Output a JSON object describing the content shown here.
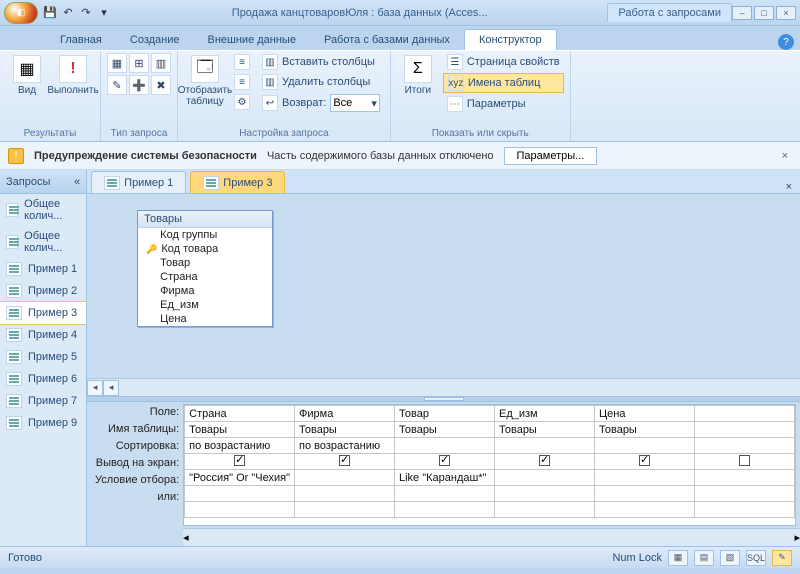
{
  "title": "Продажа канцтоваровЮля : база данных (Acces...",
  "context_tab": "Работа с запросами",
  "tabs": [
    "Главная",
    "Создание",
    "Внешние данные",
    "Работа с базами данных",
    "Конструктор"
  ],
  "ribbon": {
    "results": {
      "view": "Вид",
      "run": "Выполнить",
      "label": "Результаты"
    },
    "querytype": {
      "label": "Тип запроса"
    },
    "setup": {
      "showtable": "Отобразить таблицу",
      "insert_cols": "Вставить столбцы",
      "delete_cols": "Удалить столбцы",
      "return": "Возврат:",
      "return_value": "Все",
      "label": "Настройка запроса"
    },
    "totals": {
      "label": "Итоги"
    },
    "showhide": {
      "propsheet": "Страница свойств",
      "tablenames": "Имена таблиц",
      "params": "Параметры",
      "label": "Показать или скрыть"
    }
  },
  "security": {
    "heading": "Предупреждение системы безопасности",
    "text": "Часть содержимого базы данных отключено",
    "button": "Параметры..."
  },
  "nav": {
    "header": "Запросы",
    "items": [
      "Общее колич...",
      "Общее колич...",
      "Пример 1",
      "Пример 2",
      "Пример 3",
      "Пример 4",
      "Пример 5",
      "Пример 6",
      "Пример 7",
      "Пример 9"
    ],
    "selected": 4
  },
  "doctabs": {
    "tabs": [
      "Пример 1",
      "Пример 3"
    ],
    "active": 1
  },
  "tablebox": {
    "title": "Товары",
    "fields": [
      "Код группы",
      "Код товара",
      "Товар",
      "Страна",
      "Фирма",
      "Ед_изм",
      "Цена"
    ],
    "key_index": 1
  },
  "grid": {
    "rowlabels": [
      "Поле:",
      "Имя таблицы:",
      "Сортировка:",
      "Вывод на экран:",
      "Условие отбора:",
      "или:"
    ],
    "cols": [
      {
        "field": "Страна",
        "table": "Товары",
        "sort": "по возрастанию",
        "show": true,
        "crit": "\"Россия\" Or \"Чехия\"",
        "or": ""
      },
      {
        "field": "Фирма",
        "table": "Товары",
        "sort": "по возрастанию",
        "show": true,
        "crit": "",
        "or": ""
      },
      {
        "field": "Товар",
        "table": "Товары",
        "sort": "",
        "show": true,
        "crit": "Like \"Карандаш*\"",
        "or": ""
      },
      {
        "field": "Ед_изм",
        "table": "Товары",
        "sort": "",
        "show": true,
        "crit": "",
        "or": ""
      },
      {
        "field": "Цена",
        "table": "Товары",
        "sort": "",
        "show": true,
        "crit": "",
        "or": ""
      },
      {
        "field": "",
        "table": "",
        "sort": "",
        "show": false,
        "crit": "",
        "or": ""
      }
    ]
  },
  "status": {
    "ready": "Готово",
    "numlock": "Num Lock",
    "sql": "SQL"
  }
}
